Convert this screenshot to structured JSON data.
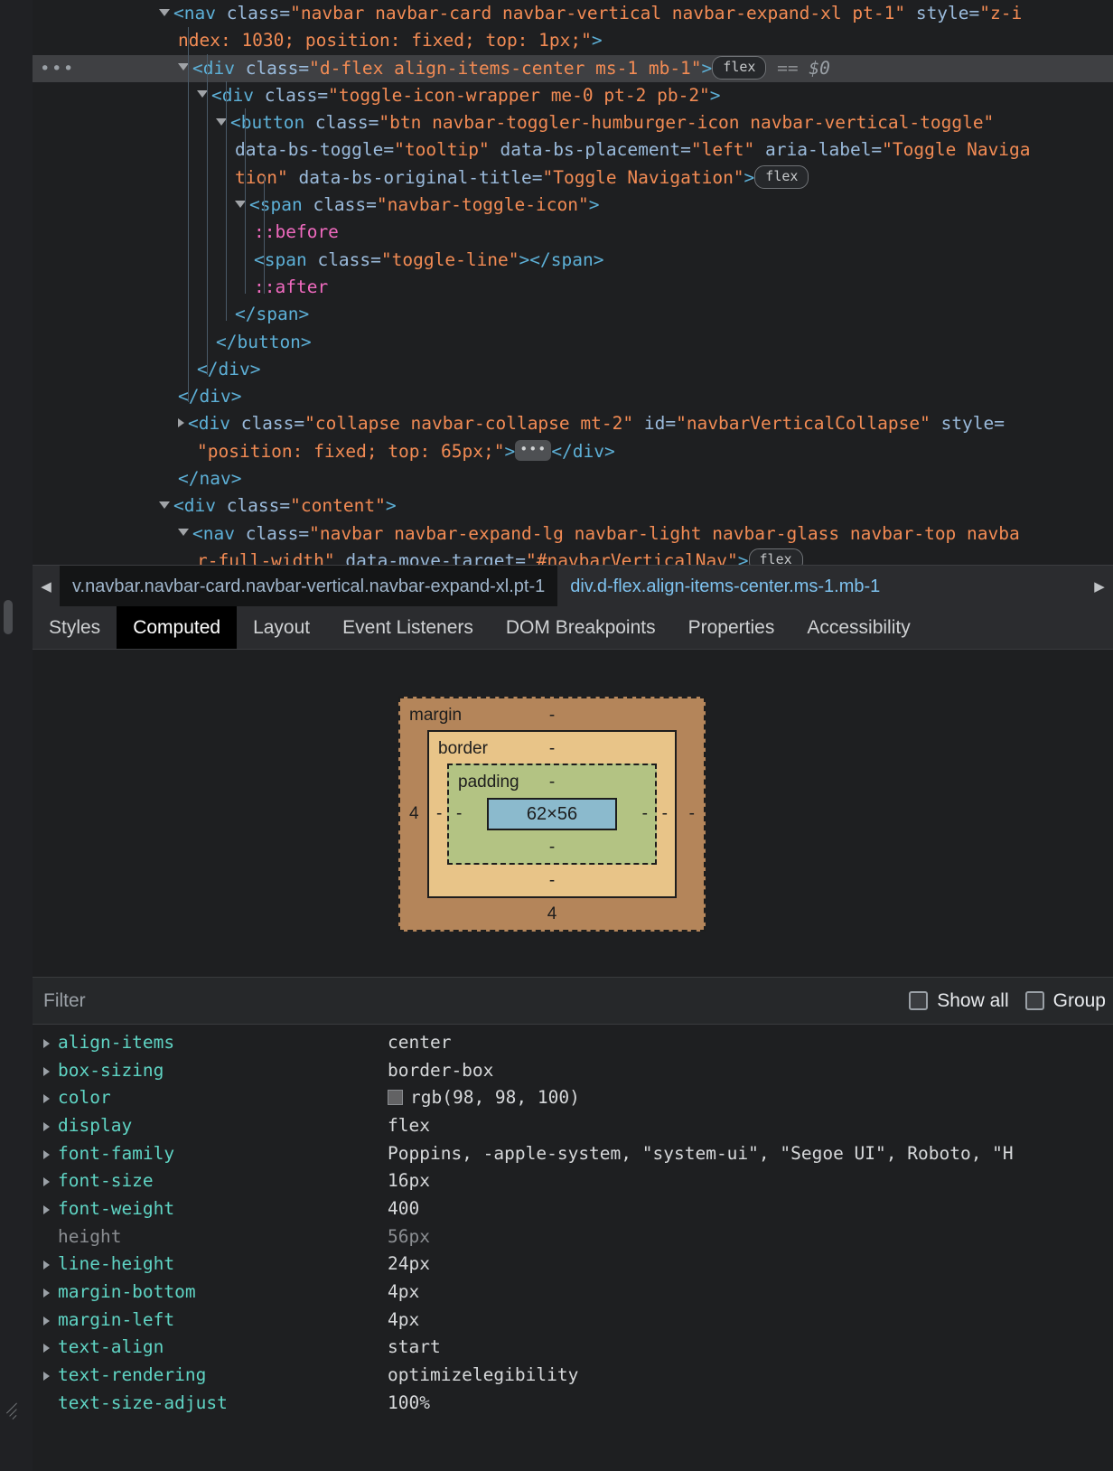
{
  "dom_tree": {
    "lines": [
      {
        "indent": 0,
        "arrow": "open",
        "parts": [
          {
            "t": "tag",
            "s": "<nav "
          },
          {
            "t": "attr",
            "s": "class="
          },
          {
            "t": "val",
            "s": "\"navbar navbar-card navbar-vertical navbar-expand-xl pt-1\" "
          },
          {
            "t": "attr",
            "s": "style="
          },
          {
            "t": "val",
            "s": "\"z-i"
          }
        ]
      },
      {
        "indent": 1,
        "arrow": "none",
        "parts": [
          {
            "t": "val",
            "s": "ndex: 1030; position: fixed; top: 1px;\""
          },
          {
            "t": "tag",
            "s": ">"
          }
        ]
      },
      {
        "indent": 1,
        "arrow": "open",
        "selected": true,
        "ellipsis": true,
        "parts": [
          {
            "t": "tag",
            "s": "<div "
          },
          {
            "t": "attr",
            "s": "class="
          },
          {
            "t": "val",
            "s": "\"d-flex align-items-center ms-1 mb-1\""
          },
          {
            "t": "tag",
            "s": ">"
          },
          {
            "t": "chip",
            "s": "flex"
          },
          {
            "t": "dim",
            "s": " == "
          },
          {
            "t": "italic",
            "s": "$0"
          }
        ]
      },
      {
        "indent": 2,
        "arrow": "open",
        "parts": [
          {
            "t": "tag",
            "s": "<div "
          },
          {
            "t": "attr",
            "s": "class="
          },
          {
            "t": "val",
            "s": "\"toggle-icon-wrapper me-0 pt-2 pb-2\""
          },
          {
            "t": "tag",
            "s": ">"
          }
        ]
      },
      {
        "indent": 3,
        "arrow": "open",
        "parts": [
          {
            "t": "tag",
            "s": "<button "
          },
          {
            "t": "attr",
            "s": "class="
          },
          {
            "t": "val",
            "s": "\"btn navbar-toggler-humburger-icon navbar-vertical-toggle\""
          }
        ]
      },
      {
        "indent": 4,
        "arrow": "none",
        "parts": [
          {
            "t": "attr",
            "s": "data-bs-toggle="
          },
          {
            "t": "val",
            "s": "\"tooltip\" "
          },
          {
            "t": "attr",
            "s": "data-bs-placement="
          },
          {
            "t": "val",
            "s": "\"left\" "
          },
          {
            "t": "attr",
            "s": "aria-label="
          },
          {
            "t": "val",
            "s": "\"Toggle Naviga"
          }
        ]
      },
      {
        "indent": 4,
        "arrow": "none",
        "parts": [
          {
            "t": "val",
            "s": "tion\" "
          },
          {
            "t": "attr",
            "s": "data-bs-original-title="
          },
          {
            "t": "val",
            "s": "\"Toggle Navigation\""
          },
          {
            "t": "tag",
            "s": ">"
          },
          {
            "t": "chip",
            "s": "flex"
          }
        ]
      },
      {
        "indent": 4,
        "arrow": "open",
        "parts": [
          {
            "t": "tag",
            "s": "<span "
          },
          {
            "t": "attr",
            "s": "class="
          },
          {
            "t": "val",
            "s": "\"navbar-toggle-icon\""
          },
          {
            "t": "tag",
            "s": ">"
          }
        ]
      },
      {
        "indent": 5,
        "arrow": "none",
        "parts": [
          {
            "t": "pseudo",
            "s": "::before"
          }
        ]
      },
      {
        "indent": 5,
        "arrow": "none",
        "parts": [
          {
            "t": "tag",
            "s": "<span "
          },
          {
            "t": "attr",
            "s": "class="
          },
          {
            "t": "val",
            "s": "\"toggle-line\""
          },
          {
            "t": "tag",
            "s": "></span>"
          }
        ]
      },
      {
        "indent": 5,
        "arrow": "none",
        "parts": [
          {
            "t": "pseudo",
            "s": "::after"
          }
        ]
      },
      {
        "indent": 4,
        "arrow": "none",
        "parts": [
          {
            "t": "tag",
            "s": "</span>"
          }
        ]
      },
      {
        "indent": 3,
        "arrow": "none",
        "parts": [
          {
            "t": "tag",
            "s": "</button>"
          }
        ]
      },
      {
        "indent": 2,
        "arrow": "none",
        "parts": [
          {
            "t": "tag",
            "s": "</div>"
          }
        ]
      },
      {
        "indent": 1,
        "arrow": "none",
        "parts": [
          {
            "t": "tag",
            "s": "</div>"
          }
        ]
      },
      {
        "indent": 1,
        "arrow": "closed",
        "parts": [
          {
            "t": "tag",
            "s": "<div "
          },
          {
            "t": "attr",
            "s": "class="
          },
          {
            "t": "val",
            "s": "\"collapse navbar-collapse mt-2\" "
          },
          {
            "t": "attr",
            "s": "id="
          },
          {
            "t": "val",
            "s": "\"navbarVerticalCollapse\" "
          },
          {
            "t": "attr",
            "s": "style="
          }
        ]
      },
      {
        "indent": 2,
        "arrow": "none",
        "parts": [
          {
            "t": "val",
            "s": "\"position: fixed; top: 65px;\""
          },
          {
            "t": "tag",
            "s": ">"
          },
          {
            "t": "dots",
            "s": "..."
          },
          {
            "t": "tag",
            "s": "</div>"
          }
        ]
      },
      {
        "indent": 1,
        "arrow": "none",
        "parts": [
          {
            "t": "tag",
            "s": "</nav>"
          }
        ]
      },
      {
        "indent": 0,
        "arrow": "open",
        "parts": [
          {
            "t": "tag",
            "s": "<div "
          },
          {
            "t": "attr",
            "s": "class="
          },
          {
            "t": "val",
            "s": "\"content\""
          },
          {
            "t": "tag",
            "s": ">"
          }
        ]
      },
      {
        "indent": 1,
        "arrow": "open",
        "parts": [
          {
            "t": "tag",
            "s": "<nav "
          },
          {
            "t": "attr",
            "s": "class="
          },
          {
            "t": "val",
            "s": "\"navbar navbar-expand-lg navbar-light navbar-glass navbar-top navba"
          }
        ]
      },
      {
        "indent": 2,
        "arrow": "none",
        "parts": [
          {
            "t": "val",
            "s": "r-full-width\" "
          },
          {
            "t": "attr",
            "s": "data-move-target="
          },
          {
            "t": "val",
            "s": "\"#navbarVerticalNav\""
          },
          {
            "t": "tag",
            "s": ">"
          },
          {
            "t": "chip",
            "s": "flex"
          }
        ]
      }
    ]
  },
  "breadcrumb": {
    "back_icon": "◀",
    "forward_icon": "▶",
    "crumbs": [
      {
        "label": "v.navbar.navbar-card.navbar-vertical.navbar-expand-xl.pt-1",
        "active": false
      },
      {
        "label": "div.d-flex.align-items-center.ms-1.mb-1",
        "active": true
      }
    ]
  },
  "tabs": {
    "items": [
      {
        "label": "Styles",
        "selected": false
      },
      {
        "label": "Computed",
        "selected": true
      },
      {
        "label": "Layout",
        "selected": false
      },
      {
        "label": "Event Listeners",
        "selected": false
      },
      {
        "label": "DOM Breakpoints",
        "selected": false
      },
      {
        "label": "Properties",
        "selected": false
      },
      {
        "label": "Accessibility",
        "selected": false
      }
    ]
  },
  "box_model": {
    "margin": {
      "label": "margin",
      "top": "-",
      "right": "-",
      "bottom": "4",
      "left": "4",
      "color": "#b4855a"
    },
    "border": {
      "label": "border",
      "top": "-",
      "right": "-",
      "bottom": "-",
      "left": "-",
      "color": "#e8c488"
    },
    "padding": {
      "label": "padding",
      "top": "-",
      "right": "-",
      "bottom": "-",
      "left": "-",
      "color": "#b3c383"
    },
    "content": {
      "size": "62×56",
      "color": "#8bbacd"
    }
  },
  "filter": {
    "placeholder": "Filter",
    "value": "",
    "show_all": {
      "label": "Show all",
      "checked": false
    },
    "group": {
      "label": "Group",
      "checked": false
    }
  },
  "computed_properties": [
    {
      "name": "align-items",
      "value": "center",
      "expandable": true,
      "inherited": false,
      "swatch": null
    },
    {
      "name": "box-sizing",
      "value": "border-box",
      "expandable": true,
      "inherited": false,
      "swatch": null
    },
    {
      "name": "color",
      "value": "rgb(98, 98, 100)",
      "expandable": true,
      "inherited": false,
      "swatch": "#626264"
    },
    {
      "name": "display",
      "value": "flex",
      "expandable": true,
      "inherited": false,
      "swatch": null
    },
    {
      "name": "font-family",
      "value": "Poppins, -apple-system, \"system-ui\", \"Segoe UI\", Roboto, \"H",
      "expandable": true,
      "inherited": false,
      "swatch": null
    },
    {
      "name": "font-size",
      "value": "16px",
      "expandable": true,
      "inherited": false,
      "swatch": null
    },
    {
      "name": "font-weight",
      "value": "400",
      "expandable": true,
      "inherited": false,
      "swatch": null
    },
    {
      "name": "height",
      "value": "56px",
      "expandable": false,
      "inherited": true,
      "swatch": null
    },
    {
      "name": "line-height",
      "value": "24px",
      "expandable": true,
      "inherited": false,
      "swatch": null
    },
    {
      "name": "margin-bottom",
      "value": "4px",
      "expandable": true,
      "inherited": false,
      "swatch": null
    },
    {
      "name": "margin-left",
      "value": "4px",
      "expandable": true,
      "inherited": false,
      "swatch": null
    },
    {
      "name": "text-align",
      "value": "start",
      "expandable": true,
      "inherited": false,
      "swatch": null
    },
    {
      "name": "text-rendering",
      "value": "optimizelegibility",
      "expandable": true,
      "inherited": false,
      "swatch": null
    },
    {
      "name": "text-size-adjust",
      "value": "100%",
      "expandable": false,
      "inherited": false,
      "swatch": null
    }
  ]
}
